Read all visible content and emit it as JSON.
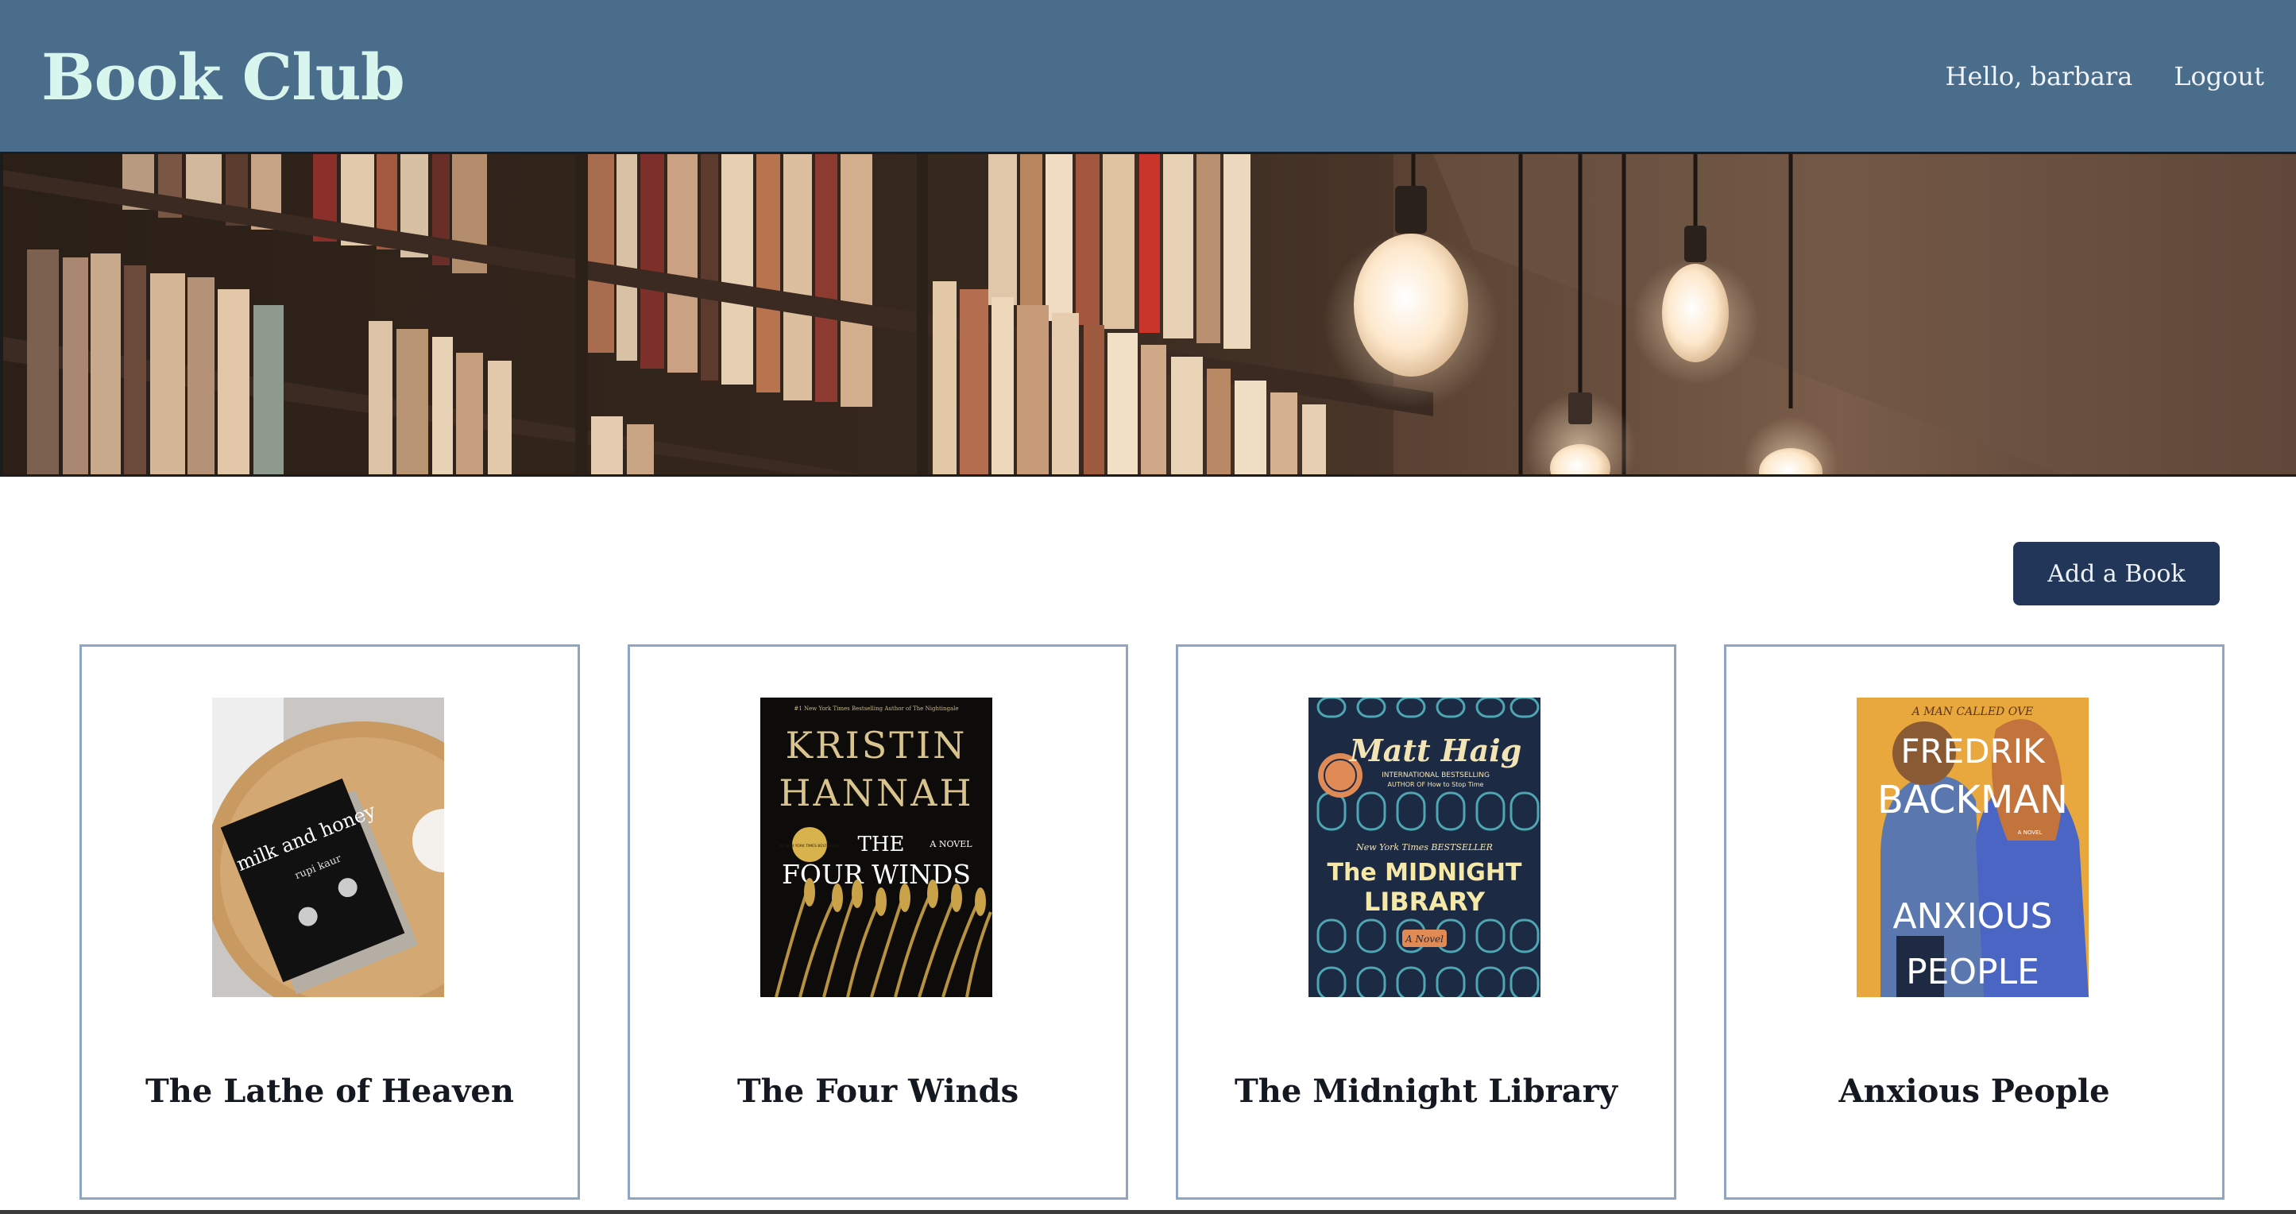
{
  "header": {
    "brand": "Book Club",
    "greeting": "Hello, barbara",
    "logout_label": "Logout"
  },
  "hero": {
    "icon": "bookshelf-banner-image"
  },
  "actions": {
    "add_book_label": "Add a Book"
  },
  "books": [
    {
      "title": "The Lathe of Heaven",
      "cover_text": {
        "title": "milk and honey",
        "author": "rupi kaur"
      }
    },
    {
      "title": "The Four Winds",
      "cover_text": {
        "tagline": "#1 New York Times Bestselling Author of The Nightingale",
        "author_first": "KRISTIN",
        "author_last": "HANNAH",
        "badge": "#1 NEW YORK TIMES BESTSELLER",
        "title_1": "THE",
        "title_2": "FOUR WINDS",
        "subtitle": "A NOVEL"
      }
    },
    {
      "title": "The Midnight Library",
      "cover_text": {
        "author": "Matt Haig",
        "line_1": "INTERNATIONAL BESTSELLING",
        "line_2": "AUTHOR OF How to Stop Time",
        "line_3": "New York Times BESTSELLER",
        "title_1": "The MIDNIGHT",
        "title_2": "LIBRARY",
        "subtitle": "A Novel"
      }
    },
    {
      "title": "Anxious People",
      "cover_text": {
        "tagline": "A MAN CALLED OVE",
        "author_first": "FREDRIK",
        "author_last": "BACKMAN",
        "subtitle": "A NOVEL",
        "title_1": "ANXIOUS",
        "title_2": "PEOPLE"
      }
    }
  ],
  "colors": {
    "navbar": "#4a6d8c",
    "brand": "#d8f5ee",
    "button": "#22365a",
    "card_border": "#8ea6c4"
  }
}
